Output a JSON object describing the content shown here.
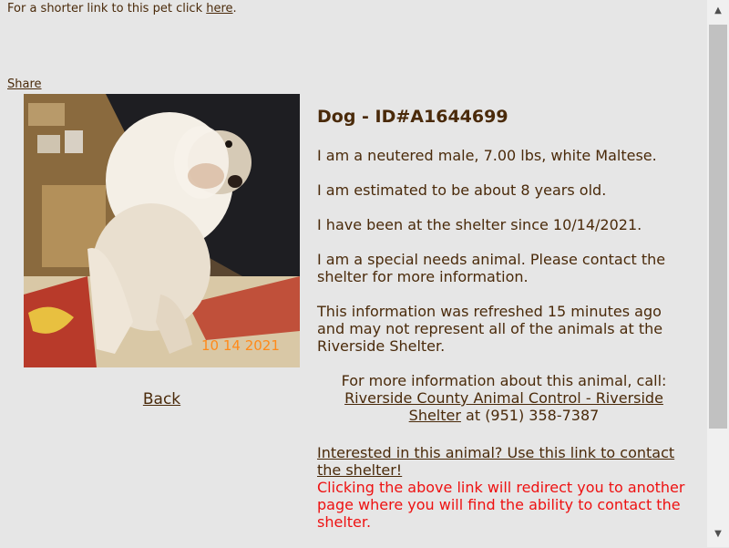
{
  "top": {
    "prefix": "For a shorter link to this pet click ",
    "link": "here",
    "suffix": "."
  },
  "share_label": "Share",
  "photo": {
    "date_stamp": "10 14 2021"
  },
  "back_label": "Back",
  "animal": {
    "title": "Dog - ID#A1644699",
    "description": "I am a neutered male, 7.00 lbs, white Maltese.",
    "age": "I am estimated to be about 8 years old.",
    "since": "I have been at the shelter since 10/14/2021.",
    "special": "I am a special needs animal. Please contact the shelter for more information.",
    "refresh": "This information was refreshed 15 minutes ago and may not represent all of the animals at the Riverside Shelter."
  },
  "contact": {
    "lead": "For more information about this animal, call:",
    "shelter_link": "Riverside County Animal Control - Riverside Shelter",
    "phone": " at (951) 358-7387"
  },
  "interested": {
    "link": "Interested in this animal? Use this link to contact the shelter!",
    "note": "Clicking the above link will redirect you to another page where you will find the ability to contact the shelter."
  },
  "scrollbar": {
    "up_icon": "▲",
    "down_icon": "▼"
  }
}
